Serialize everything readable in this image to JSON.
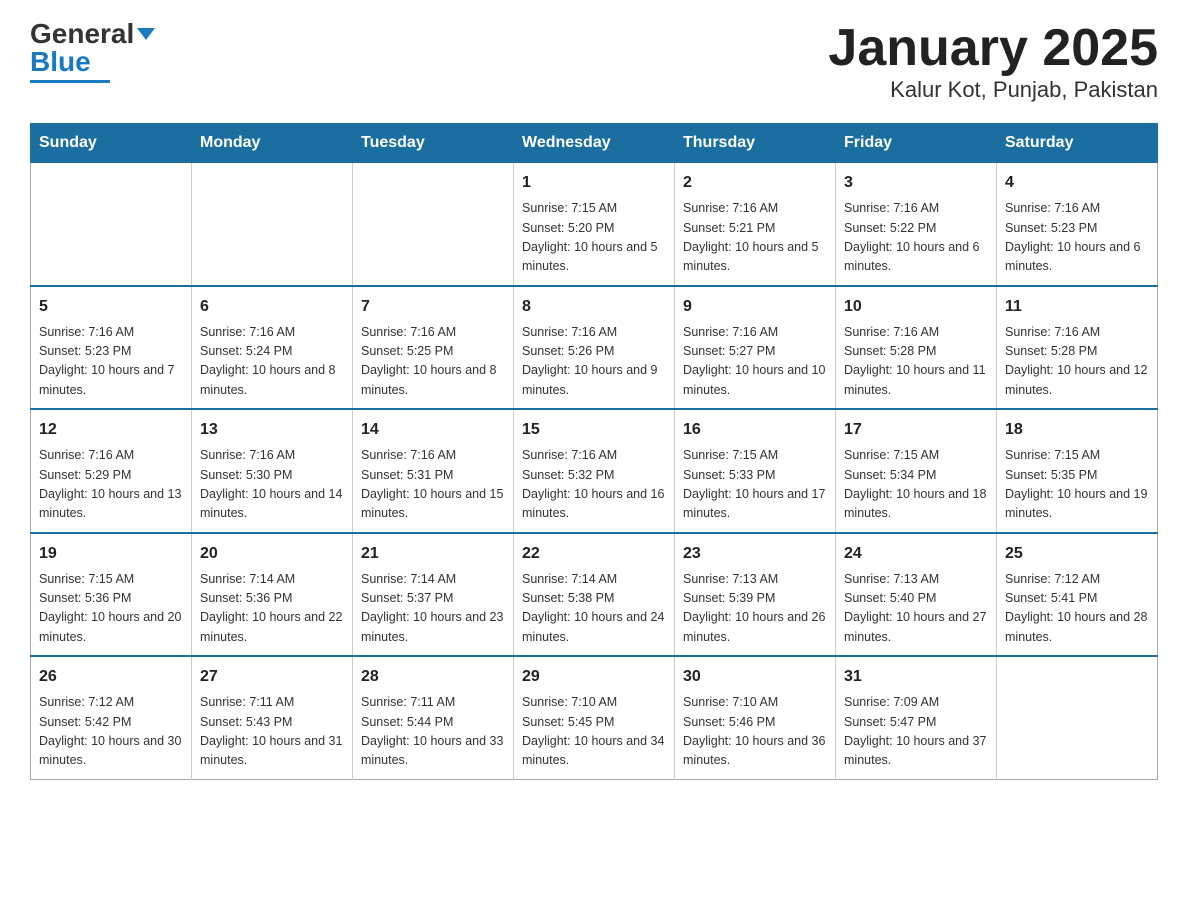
{
  "header": {
    "logo_main": "General",
    "logo_blue": "Blue",
    "title": "January 2025",
    "subtitle": "Kalur Kot, Punjab, Pakistan"
  },
  "days_of_week": [
    "Sunday",
    "Monday",
    "Tuesday",
    "Wednesday",
    "Thursday",
    "Friday",
    "Saturday"
  ],
  "weeks": [
    [
      {
        "day": "",
        "info": ""
      },
      {
        "day": "",
        "info": ""
      },
      {
        "day": "",
        "info": ""
      },
      {
        "day": "1",
        "info": "Sunrise: 7:15 AM\nSunset: 5:20 PM\nDaylight: 10 hours and 5 minutes."
      },
      {
        "day": "2",
        "info": "Sunrise: 7:16 AM\nSunset: 5:21 PM\nDaylight: 10 hours and 5 minutes."
      },
      {
        "day": "3",
        "info": "Sunrise: 7:16 AM\nSunset: 5:22 PM\nDaylight: 10 hours and 6 minutes."
      },
      {
        "day": "4",
        "info": "Sunrise: 7:16 AM\nSunset: 5:23 PM\nDaylight: 10 hours and 6 minutes."
      }
    ],
    [
      {
        "day": "5",
        "info": "Sunrise: 7:16 AM\nSunset: 5:23 PM\nDaylight: 10 hours and 7 minutes."
      },
      {
        "day": "6",
        "info": "Sunrise: 7:16 AM\nSunset: 5:24 PM\nDaylight: 10 hours and 8 minutes."
      },
      {
        "day": "7",
        "info": "Sunrise: 7:16 AM\nSunset: 5:25 PM\nDaylight: 10 hours and 8 minutes."
      },
      {
        "day": "8",
        "info": "Sunrise: 7:16 AM\nSunset: 5:26 PM\nDaylight: 10 hours and 9 minutes."
      },
      {
        "day": "9",
        "info": "Sunrise: 7:16 AM\nSunset: 5:27 PM\nDaylight: 10 hours and 10 minutes."
      },
      {
        "day": "10",
        "info": "Sunrise: 7:16 AM\nSunset: 5:28 PM\nDaylight: 10 hours and 11 minutes."
      },
      {
        "day": "11",
        "info": "Sunrise: 7:16 AM\nSunset: 5:28 PM\nDaylight: 10 hours and 12 minutes."
      }
    ],
    [
      {
        "day": "12",
        "info": "Sunrise: 7:16 AM\nSunset: 5:29 PM\nDaylight: 10 hours and 13 minutes."
      },
      {
        "day": "13",
        "info": "Sunrise: 7:16 AM\nSunset: 5:30 PM\nDaylight: 10 hours and 14 minutes."
      },
      {
        "day": "14",
        "info": "Sunrise: 7:16 AM\nSunset: 5:31 PM\nDaylight: 10 hours and 15 minutes."
      },
      {
        "day": "15",
        "info": "Sunrise: 7:16 AM\nSunset: 5:32 PM\nDaylight: 10 hours and 16 minutes."
      },
      {
        "day": "16",
        "info": "Sunrise: 7:15 AM\nSunset: 5:33 PM\nDaylight: 10 hours and 17 minutes."
      },
      {
        "day": "17",
        "info": "Sunrise: 7:15 AM\nSunset: 5:34 PM\nDaylight: 10 hours and 18 minutes."
      },
      {
        "day": "18",
        "info": "Sunrise: 7:15 AM\nSunset: 5:35 PM\nDaylight: 10 hours and 19 minutes."
      }
    ],
    [
      {
        "day": "19",
        "info": "Sunrise: 7:15 AM\nSunset: 5:36 PM\nDaylight: 10 hours and 20 minutes."
      },
      {
        "day": "20",
        "info": "Sunrise: 7:14 AM\nSunset: 5:36 PM\nDaylight: 10 hours and 22 minutes."
      },
      {
        "day": "21",
        "info": "Sunrise: 7:14 AM\nSunset: 5:37 PM\nDaylight: 10 hours and 23 minutes."
      },
      {
        "day": "22",
        "info": "Sunrise: 7:14 AM\nSunset: 5:38 PM\nDaylight: 10 hours and 24 minutes."
      },
      {
        "day": "23",
        "info": "Sunrise: 7:13 AM\nSunset: 5:39 PM\nDaylight: 10 hours and 26 minutes."
      },
      {
        "day": "24",
        "info": "Sunrise: 7:13 AM\nSunset: 5:40 PM\nDaylight: 10 hours and 27 minutes."
      },
      {
        "day": "25",
        "info": "Sunrise: 7:12 AM\nSunset: 5:41 PM\nDaylight: 10 hours and 28 minutes."
      }
    ],
    [
      {
        "day": "26",
        "info": "Sunrise: 7:12 AM\nSunset: 5:42 PM\nDaylight: 10 hours and 30 minutes."
      },
      {
        "day": "27",
        "info": "Sunrise: 7:11 AM\nSunset: 5:43 PM\nDaylight: 10 hours and 31 minutes."
      },
      {
        "day": "28",
        "info": "Sunrise: 7:11 AM\nSunset: 5:44 PM\nDaylight: 10 hours and 33 minutes."
      },
      {
        "day": "29",
        "info": "Sunrise: 7:10 AM\nSunset: 5:45 PM\nDaylight: 10 hours and 34 minutes."
      },
      {
        "day": "30",
        "info": "Sunrise: 7:10 AM\nSunset: 5:46 PM\nDaylight: 10 hours and 36 minutes."
      },
      {
        "day": "31",
        "info": "Sunrise: 7:09 AM\nSunset: 5:47 PM\nDaylight: 10 hours and 37 minutes."
      },
      {
        "day": "",
        "info": ""
      }
    ]
  ]
}
